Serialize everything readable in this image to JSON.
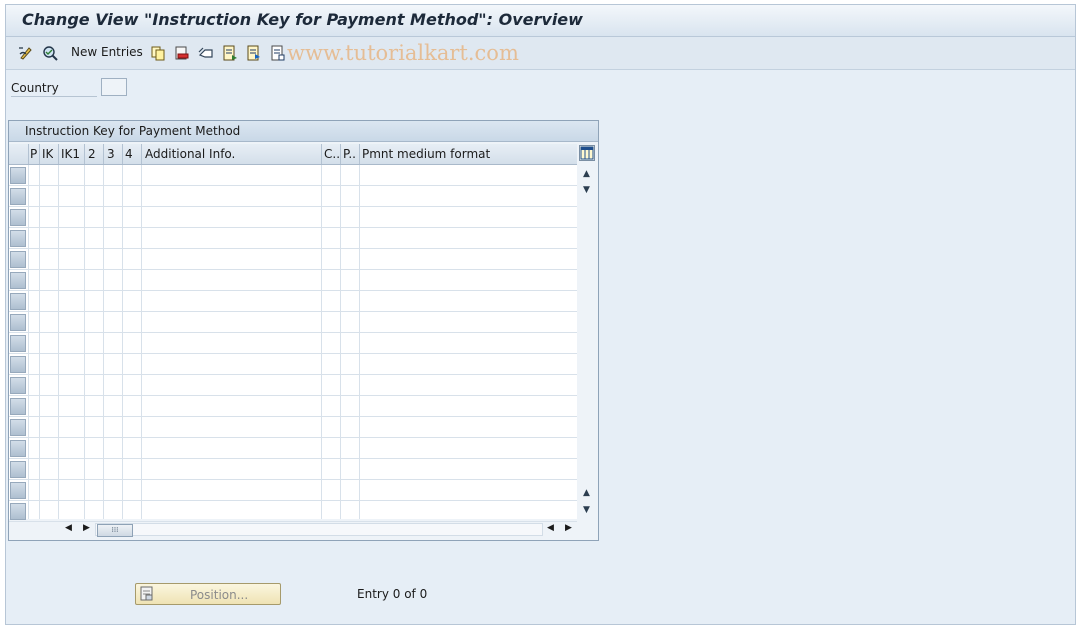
{
  "title": "Change View \"Instruction Key for Payment Method\": Overview",
  "toolbar": {
    "new_entries_label": "New Entries",
    "watermark": "www.tutorialkart.com"
  },
  "country": {
    "label": "Country",
    "value": ""
  },
  "table": {
    "title": "Instruction Key for Payment Method",
    "columns": [
      "P",
      "IK",
      "IK1",
      "2",
      "3",
      "4",
      "Additional Info.",
      "C..",
      "P..",
      "Pmnt medium format"
    ],
    "row_count": 17
  },
  "footer": {
    "position_button": "Position...",
    "entry_info": "Entry 0 of 0"
  }
}
